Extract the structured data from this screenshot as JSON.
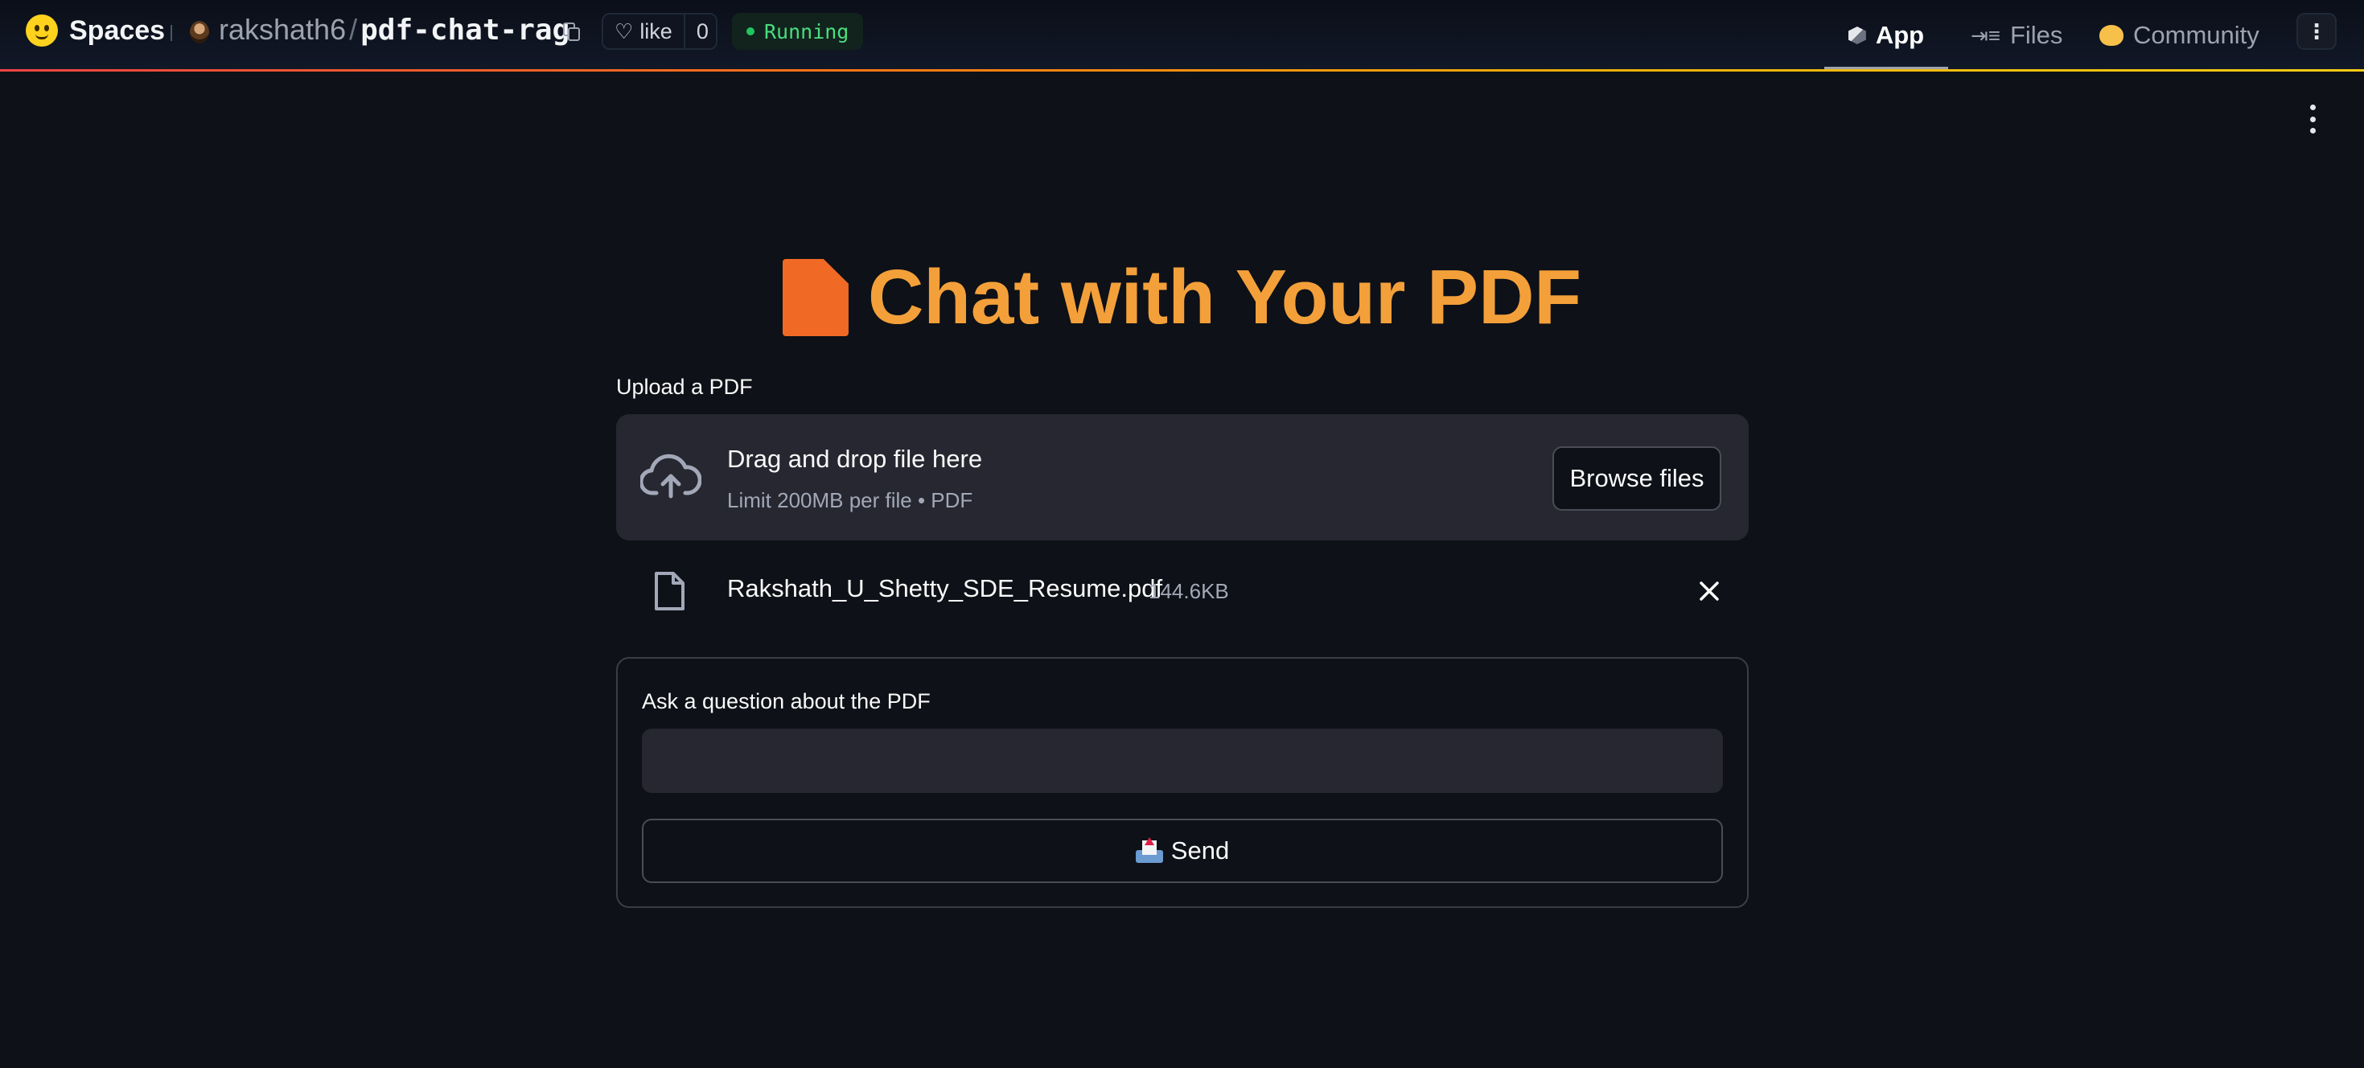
{
  "topbar": {
    "brand": "Spaces",
    "owner": "rakshath6",
    "separator": "/",
    "space_name": "pdf-chat-rag",
    "like_label": "like",
    "like_count": "0",
    "status": "Running",
    "nav": [
      {
        "label": "App",
        "icon": "cube-icon",
        "active": true
      },
      {
        "label": "Files",
        "icon": "files-icon",
        "active": false
      },
      {
        "label": "Community",
        "icon": "community-icon",
        "active": false
      }
    ],
    "accent_line_colors": [
      "#ef4444",
      "#f97316",
      "#facc15"
    ]
  },
  "app": {
    "title": "Chat with Your PDF",
    "title_icon": "pdf-document-icon",
    "title_color": "#f3a03a",
    "uploader": {
      "label": "Upload a PDF",
      "drop_text": "Drag and drop file here",
      "limit_text": "Limit 200MB per file • PDF",
      "browse_label": "Browse files"
    },
    "uploaded_file": {
      "name": "Rakshath_U_Shetty_SDE_Resume.pdf",
      "size": "144.6KB"
    },
    "question": {
      "label": "Ask a question about the PDF",
      "value": "",
      "send_label": "Send"
    }
  }
}
